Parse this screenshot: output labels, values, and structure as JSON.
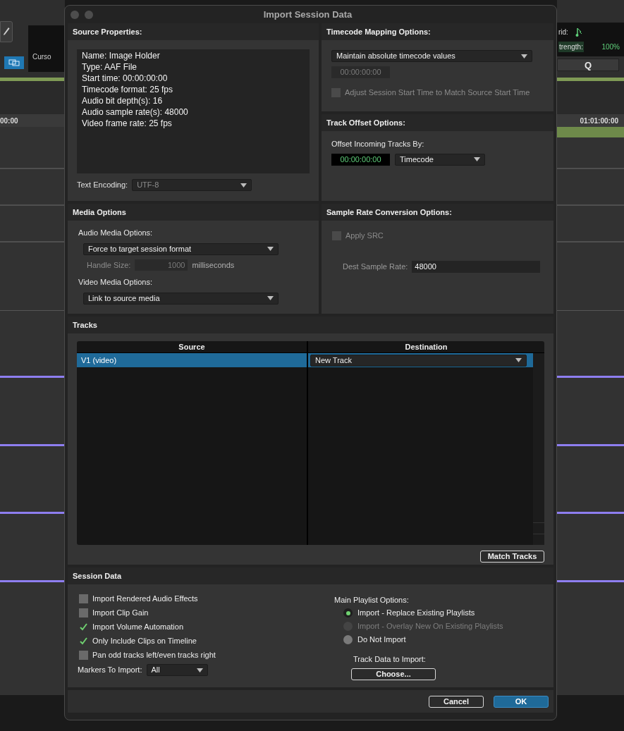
{
  "background": {
    "left": {
      "cursor_label": "Curso",
      "ruler_time": "00:00"
    },
    "right": {
      "grid_label": "rid:",
      "strength_label": "trength:",
      "strength_value": "100%",
      "quantize_button": "Q",
      "ruler_time": "01:01:00:00"
    }
  },
  "window": {
    "title": "Import Session Data"
  },
  "source_properties": {
    "title": "Source Properties:",
    "lines": [
      "Name: Image Holder",
      "Type: AAF File",
      "Start time: 00:00:00:00",
      "Timecode format: 25 fps",
      "Audio bit depth(s): 16",
      "Audio sample rate(s): 48000",
      "Video frame rate: 25 fps"
    ],
    "text_encoding": {
      "label": "Text Encoding:",
      "value": "UTF-8",
      "disabled": true
    }
  },
  "timecode_mapping": {
    "title": "Timecode Mapping Options:",
    "mode": "Maintain absolute timecode values",
    "timecode": "00:00:00:00",
    "timecode_disabled": true,
    "adjust_start": {
      "label": "Adjust Session Start Time to Match Source Start Time",
      "checked": false,
      "disabled": true
    }
  },
  "track_offset": {
    "title": "Track Offset Options:",
    "label": "Offset Incoming Tracks By:",
    "value": "00:00:00:00",
    "unit": "Timecode"
  },
  "media_options": {
    "title": "Media Options",
    "audio_label": "Audio Media Options:",
    "audio_value": "Force to target session format",
    "handle_label": "Handle Size:",
    "handle_value": "1000",
    "handle_unit": "milliseconds",
    "handle_disabled": true,
    "video_label": "Video Media Options:",
    "video_value": "Link to source media"
  },
  "sample_rate_conversion": {
    "title": "Sample Rate Conversion Options:",
    "apply_src": {
      "label": "Apply SRC",
      "checked": false,
      "disabled": true
    },
    "dest_label": "Dest Sample Rate:",
    "dest_value": "48000"
  },
  "tracks": {
    "title": "Tracks",
    "columns": [
      "Source",
      "Destination"
    ],
    "rows": [
      {
        "source": "V1 (video)",
        "destination": "New Track",
        "selected": true
      }
    ],
    "match_button": "Match Tracks"
  },
  "session_data": {
    "title": "Session Data",
    "options": [
      {
        "label": "Import Rendered Audio Effects",
        "checked": false
      },
      {
        "label": "Import Clip Gain",
        "checked": false
      },
      {
        "label": "Import Volume Automation",
        "checked": true
      },
      {
        "label": "Only Include Clips on Timeline",
        "checked": true
      },
      {
        "label": "Pan odd tracks left/even tracks right",
        "checked": false
      }
    ],
    "markers": {
      "label": "Markers To Import:",
      "value": "All"
    },
    "playlist": {
      "label": "Main Playlist Options:",
      "choices": [
        {
          "label": "Import - Replace Existing Playlists",
          "selected": true,
          "disabled": false
        },
        {
          "label": "Import - Overlay New On Existing Playlists",
          "selected": false,
          "disabled": true
        },
        {
          "label": "Do Not Import",
          "selected": false,
          "disabled": false
        }
      ]
    },
    "track_data": {
      "label": "Track Data to Import:",
      "button": "Choose..."
    }
  },
  "buttons": [
    {
      "label": "Cancel",
      "kind": "secondary"
    },
    {
      "label": "OK",
      "kind": "primary"
    }
  ]
}
